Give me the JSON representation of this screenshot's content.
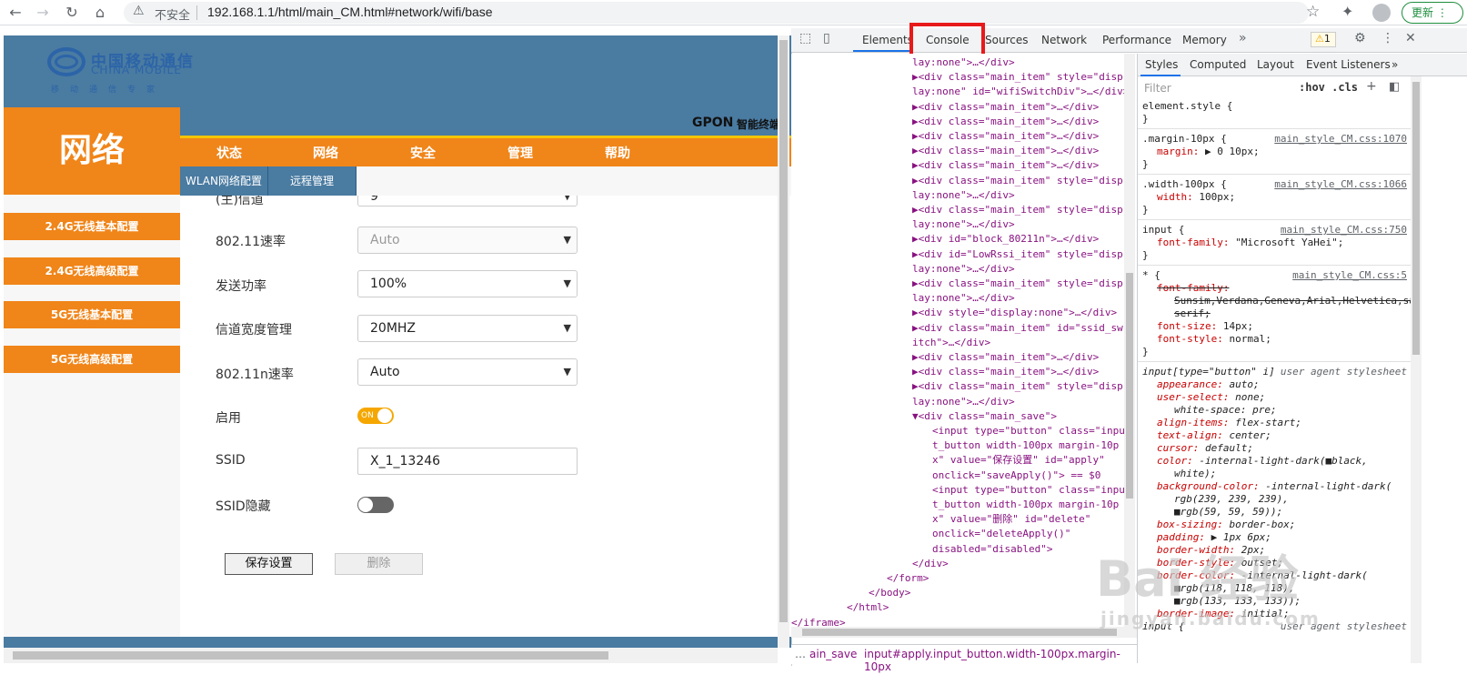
{
  "browser": {
    "security_label": "不安全",
    "url": "192.168.1.1/html/main_CM.html#network/wifi/base",
    "update_label": "更新"
  },
  "page": {
    "logo": {
      "cn": "中国移动通信",
      "en": "CHINA MOBILE",
      "sub": "移动通信专家"
    },
    "section_title": "网络",
    "product": {
      "name": "GPON",
      "suffix": "智能终端"
    },
    "menu": [
      "状态",
      "网络",
      "安全",
      "管理",
      "帮助"
    ],
    "subtabs": [
      "WLAN网络配置",
      "远程管理"
    ],
    "sidebar": [
      "2.4G无线基本配置",
      "2.4G无线高级配置",
      "5G无线基本配置",
      "5G无线高级配置"
    ],
    "form": {
      "channel_label": "(主)信道",
      "channel_value": "9",
      "rate_label": "802.11速率",
      "rate_value": "Auto",
      "power_label": "发送功率",
      "power_value": "100%",
      "bandwidth_label": "信道宽度管理",
      "bandwidth_value": "20MHZ",
      "nrate_label": "802.11n速率",
      "nrate_value": "Auto",
      "enable_label": "启用",
      "toggle_on_text": "ON",
      "ssid_label": "SSID",
      "ssid_value": "X_1_13246",
      "hide_label": "SSID隐藏",
      "save_label": "保存设置",
      "delete_label": "删除"
    }
  },
  "devtools": {
    "tabs": [
      "Elements",
      "Console",
      "Sources",
      "Network",
      "Performance",
      "Memory"
    ],
    "warning_count": "1",
    "dom_lines": [
      {
        "ind": 1,
        "text": "lay:none\">…</div>"
      },
      {
        "ind": 0,
        "text": "▶<div class=\"main_item\" style=\"disp"
      },
      {
        "ind": 1,
        "text": "lay:none\" id=\"wifiSwitchDiv\">…</div>"
      },
      {
        "ind": 0,
        "text": "▶<div class=\"main_item\">…</div>"
      },
      {
        "ind": 0,
        "text": "▶<div class=\"main_item\">…</div>"
      },
      {
        "ind": 0,
        "text": "▶<div class=\"main_item\">…</div>"
      },
      {
        "ind": 0,
        "text": "▶<div class=\"main_item\">…</div>"
      },
      {
        "ind": 0,
        "text": "▶<div class=\"main_item\">…</div>"
      },
      {
        "ind": 0,
        "text": "▶<div class=\"main_item\" style=\"disp"
      },
      {
        "ind": 1,
        "text": "lay:none\">…</div>"
      },
      {
        "ind": 0,
        "text": "▶<div class=\"main_item\" style=\"disp"
      },
      {
        "ind": 1,
        "text": "lay:none\">…</div>"
      },
      {
        "ind": 0,
        "text": "▶<div id=\"block_80211n\">…</div>"
      },
      {
        "ind": 0,
        "text": "▶<div id=\"LowRssi_item\" style=\"disp"
      },
      {
        "ind": 1,
        "text": "lay:none\">…</div>"
      },
      {
        "ind": 0,
        "text": "▶<div class=\"main_item\" style=\"disp"
      },
      {
        "ind": 1,
        "text": "lay:none\">…</div>"
      },
      {
        "ind": 0,
        "text": "▶<div style=\"display:none\">…</div>"
      },
      {
        "ind": 0,
        "text": "▶<div class=\"main_item\" id=\"ssid_sw"
      },
      {
        "ind": 1,
        "text": "itch\">…</div>"
      },
      {
        "ind": 0,
        "text": "▶<div class=\"main_item\">…</div>"
      },
      {
        "ind": 0,
        "text": "▶<div class=\"main_item\">…</div>"
      },
      {
        "ind": 0,
        "text": "▶<div class=\"main_item\" style=\"disp"
      },
      {
        "ind": 1,
        "text": "lay:none\">…</div>"
      },
      {
        "ind": 0,
        "text": "▼<div class=\"main_save\">"
      },
      {
        "ind": 2,
        "text": "<input type=\"button\" class=\"inpu"
      },
      {
        "ind": 2,
        "text": "t_button width-100px margin-10p"
      },
      {
        "ind": 2,
        "text": "x\" value=\"保存设置\" id=\"apply\""
      },
      {
        "ind": 2,
        "text": "onclick=\"saveApply()\"> == $0"
      },
      {
        "ind": 2,
        "text": "<input type=\"button\" class=\"inpu"
      },
      {
        "ind": 2,
        "text": "t_button width-100px margin-10p"
      },
      {
        "ind": 2,
        "text": "x\" value=\"删除\" id=\"delete\""
      },
      {
        "ind": 2,
        "text": "onclick=\"deleteApply()\""
      },
      {
        "ind": 2,
        "text": "disabled=\"disabled\">"
      },
      {
        "ind": 1,
        "text": "</div>"
      },
      {
        "ind": 3,
        "text": "</form>"
      },
      {
        "ind": 4,
        "text": "</body>"
      },
      {
        "ind": 5,
        "text": "</html>"
      },
      {
        "ind": 6,
        "text": "</iframe>"
      }
    ],
    "breadcrumbs": [
      "ain_save",
      "input#apply.input_button.width-100px.margin-10px"
    ],
    "styles_tabs": [
      "Styles",
      "Computed",
      "Layout",
      "Event Listeners"
    ],
    "filter_placeholder": "Filter",
    "hov_cls": ":hov  .cls",
    "rules": [
      {
        "sel": "element.style {",
        "src": ""
      },
      {
        "sel": ".margin-10px {",
        "src": "main_style_CM.css:1070",
        "decls": [
          "margin: ▶ 0 10px;"
        ]
      },
      {
        "sel": ".width-100px {",
        "src": "main_style_CM.css:1066",
        "decls": [
          "width: 100px;"
        ]
      },
      {
        "sel": "input {",
        "src": "main_style_CM.css:750",
        "decls": [
          "font-family: \"Microsoft YaHei\";"
        ]
      },
      {
        "sel": "* {",
        "src": "main_style_CM.css:5",
        "decls": [
          "font-family:",
          "Sunsim,Verdana,Geneva,Arial,Helvetica,sa",
          "serif;",
          "font-size: 14px;",
          "font-style: normal;"
        ]
      },
      {
        "sel": "input[type=\"button\" i]",
        "src": "user agent stylesheet",
        "decls": [
          "appearance: auto;",
          "user-select: none;",
          "white-space: pre;",
          "align-items: flex-start;",
          "text-align: center;",
          "cursor: default;",
          "color: -internal-light-dark(■black,",
          "white);",
          "background-color: -internal-light-dark(",
          "rgb(239, 239, 239),",
          "■rgb(59, 59, 59));",
          "box-sizing: border-box;",
          "padding: ▶ 1px 6px;",
          "border-width: 2px;",
          "border-style: outset;",
          "border-color: -internal-light-dark(",
          "■rgb(118, 118, 118),",
          "■rgb(133, 133, 133));",
          "border-image: initial;"
        ]
      },
      {
        "sel": "input {",
        "src": "user agent stylesheet"
      }
    ],
    "watermark": "Bai 经验",
    "watermark_url": "jingyan.baidu.com"
  }
}
